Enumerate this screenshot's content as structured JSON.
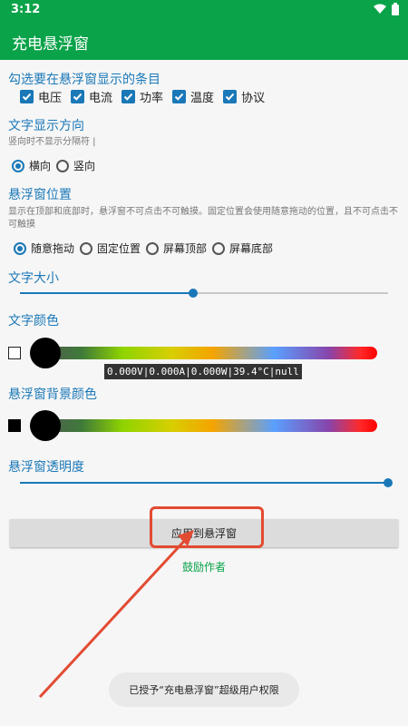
{
  "status_bar": {
    "time": "3:12"
  },
  "app_bar": {
    "title": "充电悬浮窗"
  },
  "section_items": {
    "title": "勾选要在悬浮窗显示的条目",
    "checkboxes": [
      {
        "label": "电压",
        "checked": true
      },
      {
        "label": "电流",
        "checked": true
      },
      {
        "label": "功率",
        "checked": true
      },
      {
        "label": "温度",
        "checked": true
      },
      {
        "label": "协议",
        "checked": true
      }
    ]
  },
  "section_direction": {
    "title": "文字显示方向",
    "hint": "竖向时不显示分隔符 |",
    "options": [
      {
        "label": "横向",
        "selected": true
      },
      {
        "label": "竖向",
        "selected": false
      }
    ]
  },
  "section_position": {
    "title": "悬浮窗位置",
    "hint": "显示在顶部和底部时，悬浮窗不可点击不可触摸。固定位置会使用随意拖动的位置，且不可点击不可触摸",
    "options": [
      {
        "label": "随意拖动",
        "selected": true
      },
      {
        "label": "固定位置",
        "selected": false
      },
      {
        "label": "屏幕顶部",
        "selected": false
      },
      {
        "label": "屏幕底部",
        "selected": false
      }
    ]
  },
  "section_text_size": {
    "title": "文字大小",
    "value_fraction": 0.47
  },
  "section_text_color": {
    "title": "文字颜色",
    "swatch_color": "#ffffff",
    "preview_text": "0.000V|0.000A|0.000W|39.4°C|null"
  },
  "section_bg_color": {
    "title": "悬浮窗背景颜色",
    "swatch_color": "#000000"
  },
  "section_opacity": {
    "title": "悬浮窗透明度",
    "value_fraction": 1.0
  },
  "apply_button": {
    "label": "应用到悬浮窗"
  },
  "encourage_link": {
    "label": "鼓励作者"
  },
  "toast": {
    "message": "已授予“充电悬浮窗”超级用户权限"
  },
  "colors": {
    "primary": "#0aa349",
    "accent": "#1a78b8",
    "annotation": "#e24b32"
  }
}
